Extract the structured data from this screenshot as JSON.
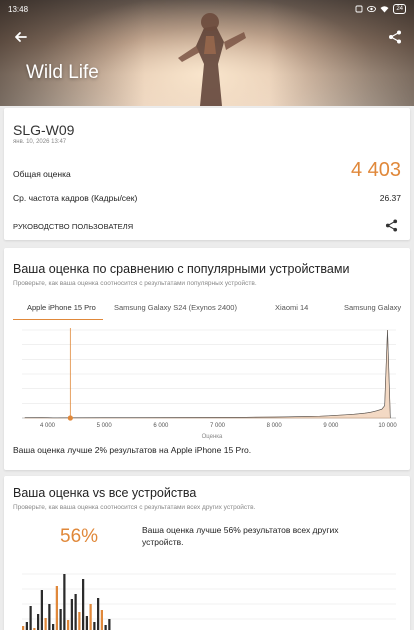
{
  "status": {
    "time": "13:48",
    "battery": "24"
  },
  "hero": {
    "title": "Wild Life"
  },
  "icons": {
    "back": "arrow-left-icon",
    "share": "share-icon"
  },
  "result": {
    "device": "SLG-W09",
    "date": "янв. 10, 2026 13:47",
    "overall_label": "Общая оценка",
    "overall_value": "4 403",
    "fps_label": "Ср. частота кадров (Кадры/сек)",
    "fps_value": "26.37",
    "guide_label": "РУКОВОДСТВО ПОЛЬЗОВАТЕЛЯ"
  },
  "compare": {
    "title": "Ваша оценка по сравнению с популярными устройствами",
    "subtitle": "Проверьте, как ваша оценка соотносится с результатами популярных устройств.",
    "tabs": [
      "Apple iPhone 15 Pro",
      "Samsung Galaxy S24 (Exynos 2400)",
      "Xiaomi 14",
      "Samsung Galaxy"
    ],
    "active_tab": 0,
    "summary": "Ваша оценка лучше 2% результатов на Apple iPhone 15 Pro."
  },
  "all": {
    "title": "Ваша оценка vs все устройства",
    "subtitle": "Проверьте, как ваша оценка соотносится с результатами всех других устройств.",
    "percent": "56%",
    "summary": "Ваша оценка лучше 56% результатов всех других устройств."
  },
  "colors": {
    "accent": "#e0883a",
    "bar_fill": "#f3d9c4",
    "bar_stroke": "#c8a68c"
  },
  "chart_data": [
    {
      "type": "area",
      "title": "",
      "xlabel": "Оценка",
      "ylabel": "",
      "xlim": [
        3550,
        10150
      ],
      "x_ticks": [
        4000,
        5000,
        6000,
        7000,
        8000,
        9000,
        10000
      ],
      "x_tick_labels": [
        "4 000",
        "5 000",
        "6 000",
        "7 000",
        "8 000",
        "9 000",
        "10 000"
      ],
      "marker_score": 4403,
      "series": [
        {
          "x": [
            3600,
            3900,
            4000,
            4100,
            5000,
            6000,
            7000,
            7500,
            8000,
            8500,
            8800,
            9000,
            9200,
            9400,
            9600,
            9700,
            9800,
            9900,
            9950,
            10000,
            10050
          ],
          "values": [
            0.3,
            0.4,
            0.3,
            0.2,
            0.3,
            0.4,
            0.6,
            0.8,
            1.1,
            1.6,
            2.0,
            2.6,
            3.4,
            4.2,
            5.5,
            6.5,
            8,
            10,
            14,
            100,
            0
          ]
        }
      ],
      "grid": true,
      "legend": "none"
    },
    {
      "type": "bar",
      "title": "",
      "values": [
        8,
        12,
        28,
        6,
        20,
        44,
        16,
        30,
        10,
        48,
        25,
        60,
        14,
        35,
        40,
        22,
        55,
        18,
        30,
        12,
        36,
        24,
        9,
        15
      ],
      "grid": true,
      "legend": "none"
    }
  ]
}
